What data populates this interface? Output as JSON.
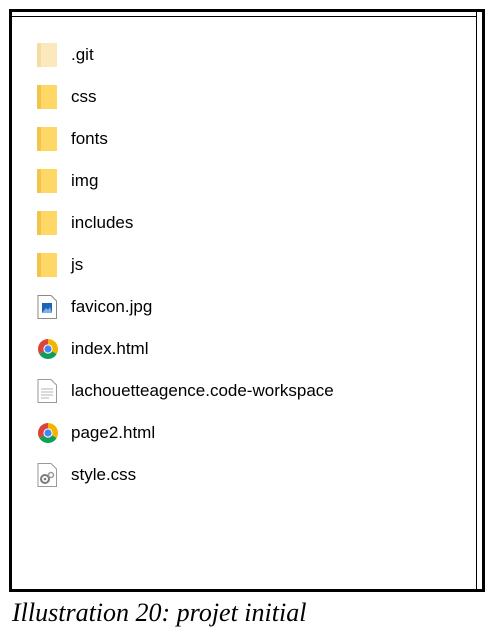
{
  "files": [
    {
      "name": ".git",
      "icon": "folder-hidden-icon"
    },
    {
      "name": "css",
      "icon": "folder-icon"
    },
    {
      "name": "fonts",
      "icon": "folder-icon"
    },
    {
      "name": "img",
      "icon": "folder-icon"
    },
    {
      "name": "includes",
      "icon": "folder-icon"
    },
    {
      "name": "js",
      "icon": "folder-icon"
    },
    {
      "name": "favicon.jpg",
      "icon": "image-file-icon"
    },
    {
      "name": "index.html",
      "icon": "chrome-icon"
    },
    {
      "name": "lachouetteagence.code-workspace",
      "icon": "text-file-icon"
    },
    {
      "name": "page2.html",
      "icon": "chrome-icon"
    },
    {
      "name": "style.css",
      "icon": "css-file-icon"
    }
  ],
  "caption": "Illustration 20: projet initial",
  "colors": {
    "folder": "#ffd766",
    "folder_hidden": "#fbe9bd",
    "chrome_red": "#db4437",
    "chrome_yellow": "#f4b400",
    "chrome_green": "#0f9d58",
    "chrome_blue": "#4285f4"
  }
}
